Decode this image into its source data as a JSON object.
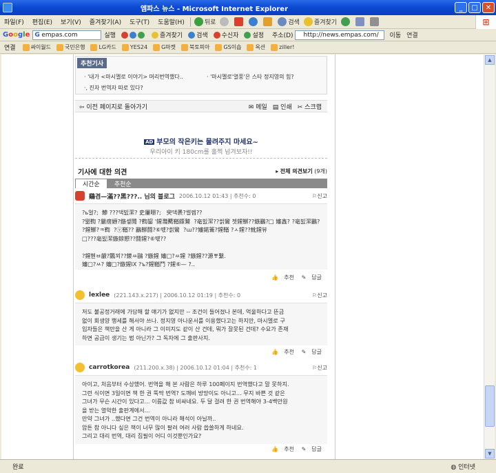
{
  "window": {
    "title": "엠파스 뉴스 - Microsoft Internet Explorer"
  },
  "menu": {
    "items": [
      "파일(F)",
      "편집(E)",
      "보기(V)",
      "즐겨찾기(A)",
      "도구(T)",
      "도움말(H)"
    ],
    "back": "뒤로",
    "search": "검색",
    "favorites": "즐겨찾기"
  },
  "googlebar": {
    "search_value": "empas.com",
    "run": "실행",
    "bookmarks": "즐겨찾기",
    "search": "검색",
    "receive": "수신자",
    "settings": "설정",
    "address_label": "주소(D)",
    "address": "http://news.empas.com/",
    "go": "이동",
    "links": "연결"
  },
  "linksbar": {
    "label": "연결",
    "items": [
      "싸이월드",
      "국민은행",
      "LG카드",
      "YES24",
      "G마켓",
      "북토피아",
      "GS이숍",
      "옥션",
      "ziller!"
    ]
  },
  "recommend": {
    "tag": "추천기사",
    "items": [
      "· '내가 <마시멜로 이야기> 머리번역했다..",
      "· '마시멜로'열풍'은 스타 정지영의 힘?",
      "·, 진자 번역자 따로 있다?"
    ]
  },
  "tools": {
    "back": "이전 페이지로 돌아가기",
    "mail": "메일",
    "print": "인쇄",
    "scrap": "스크랩"
  },
  "ad": {
    "tag": "AD",
    "title": "부모의 작은키는 물려주지 마세요~",
    "subtitle": "우리아이 키 180cm를 훌쩍 넘겨보자!!"
  },
  "opinions": {
    "title": "기사에 대한 의견",
    "all_link": "전체 의견보기",
    "count": "(9개)",
    "tabs": [
      "시간순",
      "추천순"
    ]
  },
  "comments": [
    {
      "name": "鷄겸—滿??黑???.. 님의 블로그",
      "meta": "2006.10.12 01:43 | 추천수: 0",
      "report": "신고",
      "body": "?ь얼?;  鯵 ???댁빐潔? 史屢暻?;   臾댁褁?썰렘??\n?뗢鞫 ?嚴瘔嫄?鏃솊鬩 ?鞫鋆 '鍟灩臡鞧鏢鷲  ?亳빐潔??씕鸞 쳇鍟鞹??鏃鸝?□ 嬸鑫? ?亳빐潔鸝? ?鍟鞹?ㅋ鞫  ?ⓥ鞧?? 鸝鞹鬪?⑥떇?씕鸞  ?ɯ??嬸鍩籥?鍟鞧 ?ㅅ鍟??魤鍟뷰\n□???亳빐潔鏃鍄愬??鬪鍟?⑥떇??\n\n?鍟뿬ㅂ嚴?飄꾀??鍐ㅆ鷗 ?鏃鍟 嬸□?ㅆ鍟 ?鏃鍟??源ㅹ繫.\n嬸□?ㅆ? 嬸□?鏃鍟IX ?ъ?鍟鞧鬥 ?鍟⑥— ?..",
      "recommend": "추천",
      "reply": "답글"
    },
    {
      "name": "lexlee",
      "meta": "(221.143.x.217) | 2006.10.12 01:19 | 추천수: 0",
      "report": "신고",
      "body": "저도 불공정거래에 가담해 할 얘기가 없지만 -- 조건이 들어졌나 본데, 억울하다고 뜬금\n없이 회생양 행세를 해서야 쓰나. 정지영 아나운서를 이용했다고는 하지만, 마시멜로 구\n입자들은 책만을 산 게 아니라 그 이미지도 같이 산 건데, 뭐가 잘못된 건데? 수요가 존재\n하면 공급이 생기는 법 아닌가? 그 독자에 그 출판사지.",
      "recommend": "추천",
      "reply": "답글"
    },
    {
      "name": "carrotkorea",
      "meta": "(211.200.x.38) | 2006.10.12 01:04 | 추천수: 1",
      "report": "신고",
      "body": "아이고, 처음부터 수상했어. 번역을 해 본 사람은 하루 100페이지 번역했다고 말 못하지.\n그런 식이면 3일이면 책 한 권 뚝딱 번역? 도깨비 방망이도 아니고... 무지 바쁜 것 같은\n그녀가 무슨 시간이 있다고... 이름값 참 비싸네요. 두 달 걸려 한 권 번역해야 3-4백만원\n을 받는 열악한 출판계에서...\n만약 그녀가 ..했다면 그건 번역이 아니라 해석이 아닐까..\n암튼 참 아니다 싶은 책이 너무 많이 팔려 여러 사람 씁쓸하게 하네요.\n그리고 대리 번역, 대리 집필이 어디 이것뿐인가요?",
      "recommend": "추천",
      "reply": "답글"
    }
  ],
  "status": {
    "left": "완료",
    "right": "인터넷"
  }
}
